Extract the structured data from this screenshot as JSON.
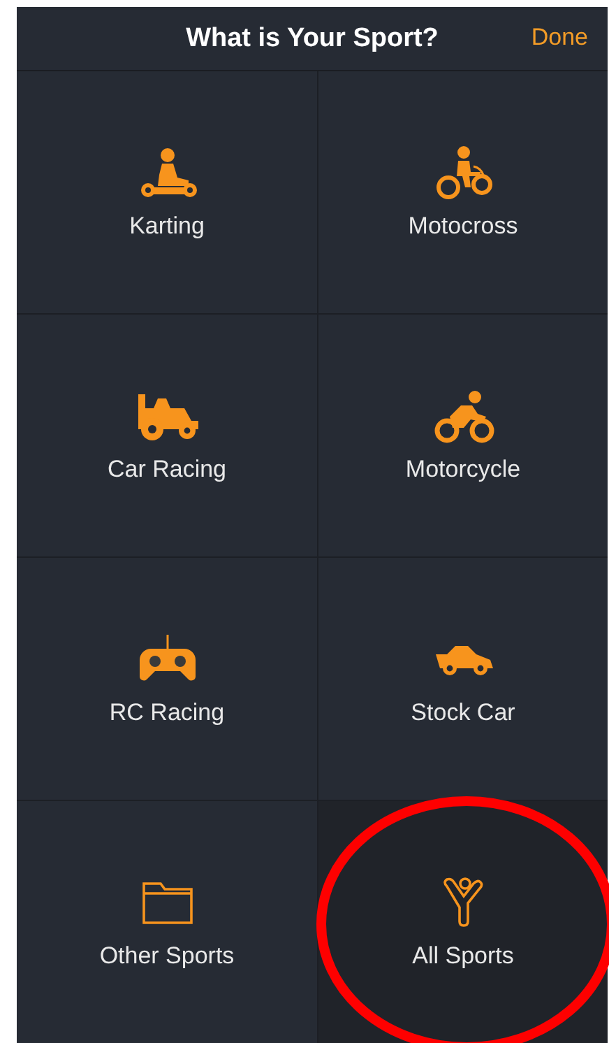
{
  "header": {
    "title": "What is Your Sport?",
    "done": "Done"
  },
  "sports": [
    {
      "kind": "kart",
      "label": "Karting",
      "selected": false
    },
    {
      "kind": "motocross",
      "label": "Motocross",
      "selected": false
    },
    {
      "kind": "formula",
      "label": "Car Racing",
      "selected": false
    },
    {
      "kind": "motorcycle",
      "label": "Motorcycle",
      "selected": false
    },
    {
      "kind": "controller",
      "label": "RC Racing",
      "selected": false
    },
    {
      "kind": "stockcar",
      "label": "Stock Car",
      "selected": false
    },
    {
      "kind": "folder",
      "label": "Other Sports",
      "selected": false
    },
    {
      "kind": "all",
      "label": "All Sports",
      "selected": true
    }
  ]
}
